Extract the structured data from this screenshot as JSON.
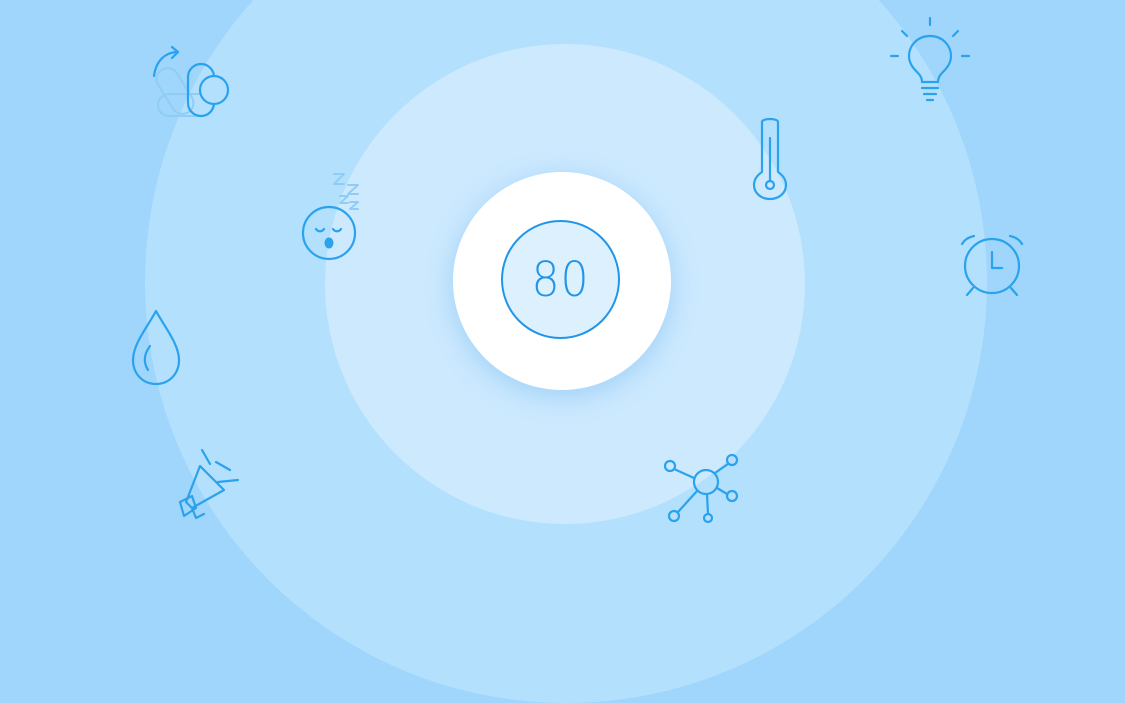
{
  "center": {
    "value": "80"
  },
  "icons": [
    "pills-icon",
    "lightbulb-icon",
    "sleep-face-icon",
    "thermometer-icon",
    "alarm-clock-icon",
    "water-drop-icon",
    "megaphone-icon",
    "network-hub-icon"
  ],
  "colors": {
    "background": "#a0d6fb",
    "ring_outer": "#b3e0fd",
    "ring_inner": "#cce9fe",
    "core": "#ffffff",
    "accent": "#2196e8",
    "icon_stroke": "#2aa2ee"
  }
}
